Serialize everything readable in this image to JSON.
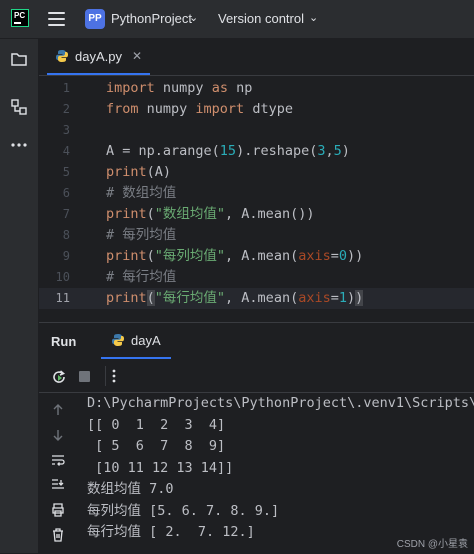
{
  "titlebar": {
    "logo_text": "PC",
    "project_badge": "PP",
    "project_name": "PythonProject",
    "vcs_label": "Version control"
  },
  "toolstrip": {
    "icons": [
      "folder-icon",
      "structure-icon",
      "more-icon"
    ]
  },
  "editor": {
    "tab_label": "dayA.py",
    "current_line": 11,
    "lines": [
      {
        "n": "1",
        "tokens": [
          [
            "kw",
            "import"
          ],
          [
            "p",
            " numpy "
          ],
          [
            "kw",
            "as"
          ],
          [
            "p",
            " np"
          ]
        ]
      },
      {
        "n": "2",
        "tokens": [
          [
            "kw",
            "from"
          ],
          [
            "p",
            " numpy "
          ],
          [
            "kw",
            "import"
          ],
          [
            "p",
            " dtype"
          ]
        ]
      },
      {
        "n": "3",
        "tokens": []
      },
      {
        "n": "4",
        "tokens": [
          [
            "p",
            "A = np.arange("
          ],
          [
            "num",
            "15"
          ],
          [
            "p",
            ").reshape("
          ],
          [
            "num",
            "3"
          ],
          [
            "p",
            ","
          ],
          [
            "num",
            "5"
          ],
          [
            "p",
            ")"
          ]
        ]
      },
      {
        "n": "5",
        "tokens": [
          [
            "kw",
            "print"
          ],
          [
            "p",
            "(A)"
          ]
        ]
      },
      {
        "n": "6",
        "tokens": [
          [
            "cmt",
            "# 数组均值"
          ]
        ]
      },
      {
        "n": "7",
        "tokens": [
          [
            "kw",
            "print"
          ],
          [
            "p",
            "("
          ],
          [
            "str",
            "\"数组均值\""
          ],
          [
            "p",
            ", A.mean())"
          ]
        ]
      },
      {
        "n": "8",
        "tokens": [
          [
            "cmt",
            "# 每列均值"
          ]
        ]
      },
      {
        "n": "9",
        "tokens": [
          [
            "kw",
            "print"
          ],
          [
            "p",
            "("
          ],
          [
            "str",
            "\"每列均值\""
          ],
          [
            "p",
            ", A.mean("
          ],
          [
            "param",
            "axis"
          ],
          [
            "p",
            "="
          ],
          [
            "num",
            "0"
          ],
          [
            "p",
            "))"
          ]
        ]
      },
      {
        "n": "10",
        "tokens": [
          [
            "cmt",
            "# 每行均值"
          ]
        ]
      },
      {
        "n": "11",
        "tokens": [
          [
            "kw",
            "print"
          ],
          [
            "hl",
            "("
          ],
          [
            "str",
            "\"每行均值\""
          ],
          [
            "p",
            ", A.mean("
          ],
          [
            "param",
            "axis"
          ],
          [
            "p",
            "="
          ],
          [
            "num",
            "1"
          ],
          [
            "p",
            ")"
          ],
          [
            "hl",
            ")"
          ]
        ]
      }
    ]
  },
  "run": {
    "title": "Run",
    "tab_label": "dayA",
    "console_lines": [
      "D:\\PycharmProjects\\PythonProject\\.venv1\\Scripts\\pyt",
      "[[ 0  1  2  3  4]",
      " [ 5  6  7  8  9]",
      " [10 11 12 13 14]]",
      "数组均值 7.0",
      "每列均值 [5. 6. 7. 8. 9.]",
      "每行均值 [ 2.  7. 12.]"
    ]
  },
  "watermark": "CSDN @小星袁",
  "colors": {
    "accent": "#3574f0",
    "keyword": "#cf8e6d",
    "number": "#2aacb8",
    "string": "#6aab73",
    "comment": "#7a7e85",
    "param": "#aa4926"
  }
}
